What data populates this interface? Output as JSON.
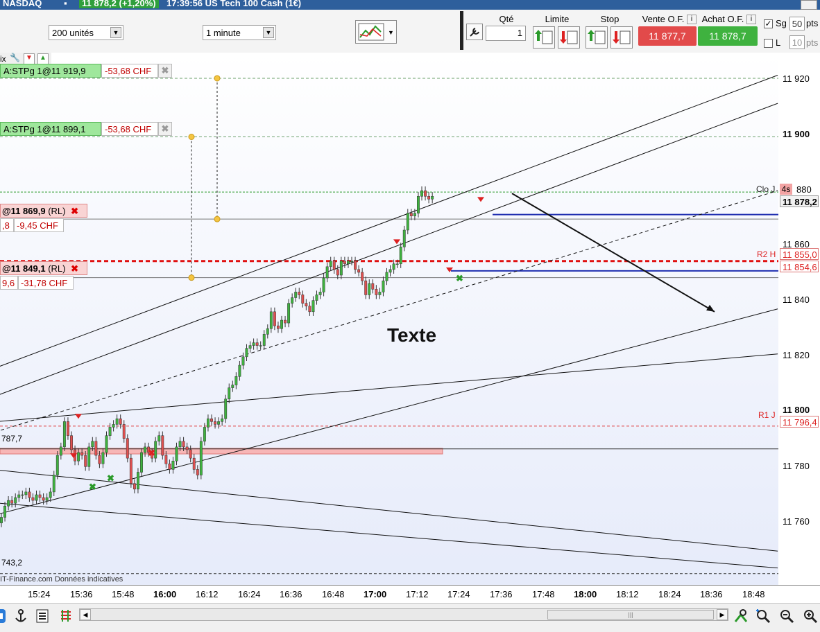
{
  "titlebar": {
    "instrument": "NASDAQ",
    "price_badge": "11 878,2 (+1,20%)",
    "time_and_name": "17:39:56 US Tech 100 Cash (1€)"
  },
  "toolbar": {
    "units_select": "200 unités",
    "interval_select": "1 minute",
    "qty_header": "Qté",
    "qty_value": "1",
    "limit_header": "Limite",
    "stop_header": "Stop",
    "sell_header": "Vente O.F.",
    "buy_header": "Achat O.F.",
    "sell_price": "11 877,7",
    "buy_price": "11 878,7",
    "sg_label": "Sg",
    "sg_value": "50",
    "sg_unit": "pts",
    "l_label": "L",
    "l_value": "10",
    "l_unit": "pts",
    "sg_checked": true,
    "l_checked": false
  },
  "chart": {
    "partial_label": "ix",
    "text_annotation": "Texte",
    "source_note": "IT-Finance.com  Données indicatives",
    "orders": [
      {
        "label": "A:STPg 1@11 919,9",
        "pnl": "-53,68 CHF"
      },
      {
        "label": "A:STPg 1@11 899,1",
        "pnl": "-53,68 CHF"
      }
    ],
    "positions": [
      {
        "label": "@11 869,9",
        "tag": "(RL)",
        "left": ",8",
        "pnl": "-9,45 CHF"
      },
      {
        "label": "@11 849,1",
        "tag": "(RL)",
        "left": "9,6",
        "pnl": "-31,78 CHF"
      }
    ],
    "left_level_a": "787,7",
    "left_level_b": "743,2",
    "r1_label": "R1 J",
    "r2_label": "R2 H",
    "clo_label": "Clo J",
    "timer_label": "4s"
  },
  "yaxis": {
    "labels": [
      "11 920",
      "11 900",
      "880",
      "11 860",
      "11 840",
      "11 820",
      "11 800",
      "11 780",
      "11 760"
    ],
    "bold_labels": [
      "11 900",
      "11 800"
    ],
    "price_box": "11 878,2",
    "r2_box": "11 855,0",
    "r2b_box": "11 854,6",
    "r1_box": "11 796,4"
  },
  "xaxis": {
    "labels": [
      "15:24",
      "15:36",
      "15:48",
      "16:00",
      "16:12",
      "16:24",
      "16:36",
      "16:48",
      "17:00",
      "17:12",
      "17:24",
      "17:36",
      "17:48",
      "18:00",
      "18:12",
      "18:24",
      "18:36",
      "18:48"
    ],
    "bold_labels": [
      "16:00",
      "17:00",
      "18:00"
    ]
  },
  "chart_data": {
    "type": "candlestick",
    "x_start": "15:16",
    "x_step_minutes": 1,
    "y_range": [
      11740,
      11929
    ],
    "ohlc_close": [
      11764,
      11768,
      11770,
      11769,
      11771,
      11772,
      11772,
      11773,
      11771,
      11770,
      11772,
      11771,
      11770,
      11771,
      11773,
      11779,
      11786,
      11789,
      11798,
      11793,
      11788,
      11784,
      11787,
      11786,
      11782,
      11789,
      11791,
      11786,
      11783,
      11787,
      11793,
      11796,
      11797,
      11799,
      11797,
      11792,
      11785,
      11776,
      11774,
      11780,
      11787,
      11789,
      11787,
      11785,
      11791,
      11793,
      11786,
      11783,
      11781,
      11784,
      11789,
      11791,
      11789,
      11788,
      11785,
      11781,
      11779,
      11791,
      11796,
      11799,
      11798,
      11797,
      11798,
      11799,
      11806,
      11810,
      11811,
      11814,
      11818,
      11821,
      11824,
      11825,
      11826,
      11825,
      11825,
      11829,
      11831,
      11837,
      11832,
      11831,
      11834,
      11833,
      11840,
      11842,
      11844,
      11843,
      11840,
      11839,
      11837,
      11841,
      11843,
      11844,
      11849,
      11853,
      11855,
      11852,
      11850,
      11855,
      11854,
      11855,
      11855,
      11852,
      11851,
      11848,
      11843,
      11847,
      11845,
      11843,
      11844,
      11848,
      11851,
      11852,
      11854,
      11854,
      11860,
      11866,
      11872,
      11871,
      11872,
      11878,
      11880,
      11878,
      11877,
      11878
    ],
    "levels": [
      {
        "name": "A:STPg 11 919,9",
        "y": 11919.9
      },
      {
        "name": "A:STPg 11 899,1",
        "y": 11899.1
      },
      {
        "name": "11 869,9",
        "y": 11869.9
      },
      {
        "name": "11 849,1",
        "y": 11849.1
      },
      {
        "name": "R2 H",
        "y": 11855.0
      },
      {
        "name": "R1 J",
        "y": 11796.4
      },
      {
        "name": "Clo J",
        "y": 11879.5
      }
    ]
  },
  "bottombar": {
    "icons": [
      "cursor-icon",
      "anchor-icon",
      "chart-config-icon",
      "objects-icon",
      "zoom-fit-icon",
      "zoom-auto-icon",
      "zoom-out-icon",
      "zoom-in-icon"
    ]
  }
}
